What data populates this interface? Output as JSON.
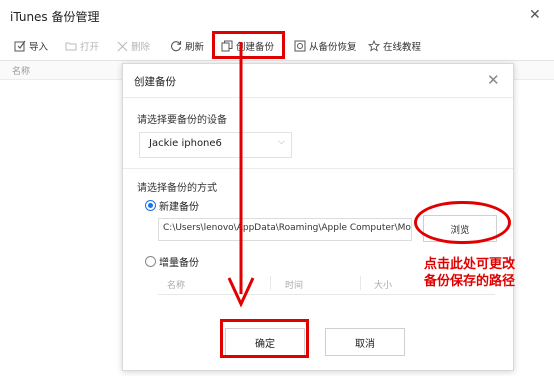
{
  "app": {
    "title": "iTunes 备份管理",
    "close_glyph": "✕"
  },
  "toolbar": {
    "import": "导入",
    "open": "打开",
    "delete": "删除",
    "refresh": "刷新",
    "create_backup": "创建备份",
    "restore": "从备份恢复",
    "tutorial": "在线教程"
  },
  "list": {
    "col_name": "名称"
  },
  "dialog": {
    "title": "创建备份",
    "close_glyph": "✕",
    "device_label": "请选择要备份的设备",
    "device_value": "Jackie iphone6",
    "method_label": "请选择备份的方式",
    "option_new": "新建备份",
    "option_new_selected": true,
    "path_value": "C:\\Users\\lenovo\\AppData\\Roaming\\Apple Computer\\MobileSync\\Backup",
    "browse_label": "浏览",
    "option_incremental": "增量备份",
    "table_cols": [
      "名称",
      "时间",
      "大小"
    ],
    "ok_label": "确定",
    "cancel_label": "取消"
  },
  "annotation": {
    "line1": "点击此处可更改",
    "line2": "备份保存的路径",
    "color": "#e10000"
  },
  "colors": {
    "accent": "#1a73e8",
    "highlight": "#e10000"
  },
  "icons": [
    "import-icon",
    "open-folder-icon",
    "delete-icon",
    "refresh-icon",
    "create-backup-icon",
    "restore-icon",
    "star-icon",
    "chevron-down-icon",
    "close-icon"
  ]
}
